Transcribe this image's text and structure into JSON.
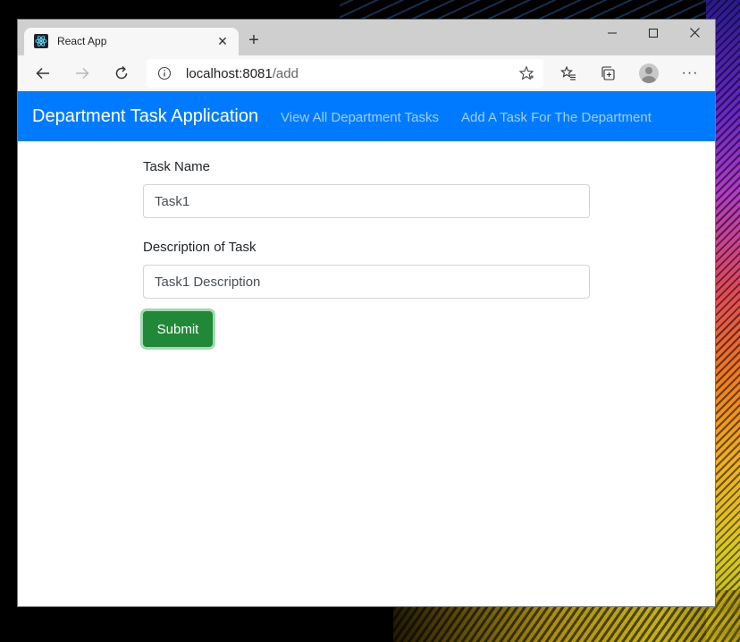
{
  "browser": {
    "tab": {
      "title": "React App",
      "favicon": "react-logo-icon"
    },
    "window_controls": [
      "minimize-icon",
      "maximize-icon",
      "close-icon"
    ],
    "address_bar": {
      "host": "localhost:8081",
      "path": "/add"
    },
    "toolbar_icons": [
      "back-icon",
      "forward-icon",
      "reload-icon",
      "info-icon",
      "favorite-star-icon",
      "favorites-icon",
      "collections-icon",
      "profile-avatar",
      "more-icon"
    ]
  },
  "navbar": {
    "brand": "Department Task Application",
    "links": [
      "View All Department Tasks",
      "Add A Task For The Department"
    ],
    "background": "#007bff"
  },
  "form": {
    "task_name": {
      "label": "Task Name",
      "value": "Task1"
    },
    "description": {
      "label": "Description of Task",
      "value": "Task1 Description"
    },
    "submit_label": "Submit",
    "submit_color": "#218838"
  }
}
